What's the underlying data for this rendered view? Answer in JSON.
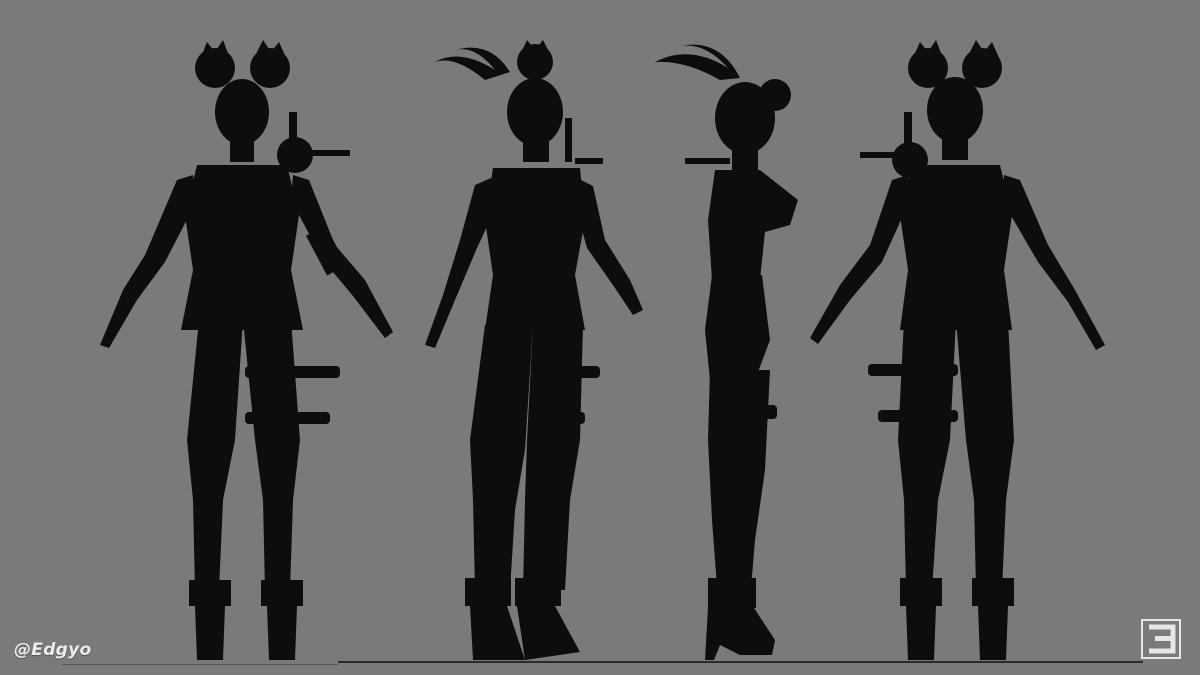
{
  "watermark": {
    "handle": "@Edgyo"
  },
  "logo": {
    "icon": "artist-logo-icon",
    "color": "#e6e6e6"
  },
  "colors": {
    "background": "#7a7a7a",
    "silhouette": "#0d0d0d",
    "ground": "#2b2b2b"
  },
  "views": [
    "front",
    "three-quarter",
    "side",
    "back"
  ]
}
